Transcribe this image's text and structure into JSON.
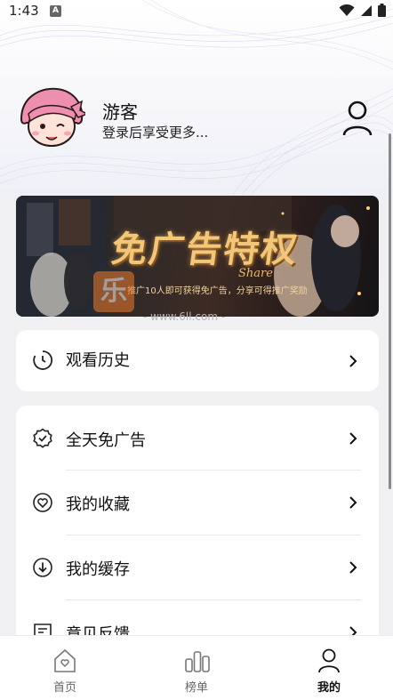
{
  "status_bar": {
    "time": "1:43",
    "notification_badge": "A"
  },
  "profile": {
    "name": "游客",
    "subtitle": "登录后享受更多..."
  },
  "banner": {
    "title": "免广告特权",
    "share": "Share",
    "description": "推广10人即可获得免广告，分享可得推广奖励"
  },
  "watermark": {
    "logo_glyph": "乐",
    "text": "- www.6ll.com -"
  },
  "menu_primary": [
    {
      "label": "观看历史",
      "icon": "history-clock-icon"
    }
  ],
  "menu_secondary": [
    {
      "label": "全天免广告",
      "icon": "badge-check-icon"
    },
    {
      "label": "我的收藏",
      "icon": "heart-circle-icon"
    },
    {
      "label": "我的缓存",
      "icon": "download-circle-icon"
    },
    {
      "label": "意见反馈",
      "icon": "feedback-icon"
    }
  ],
  "bottom_nav": [
    {
      "label": "首页",
      "icon": "home-heart-icon",
      "active": false
    },
    {
      "label": "榜单",
      "icon": "ranking-bars-icon",
      "active": false
    },
    {
      "label": "我的",
      "icon": "profile-icon",
      "active": true
    }
  ],
  "colors": {
    "accent": "#f3c77a",
    "background": "#f0f0f2",
    "card": "#ffffff"
  }
}
